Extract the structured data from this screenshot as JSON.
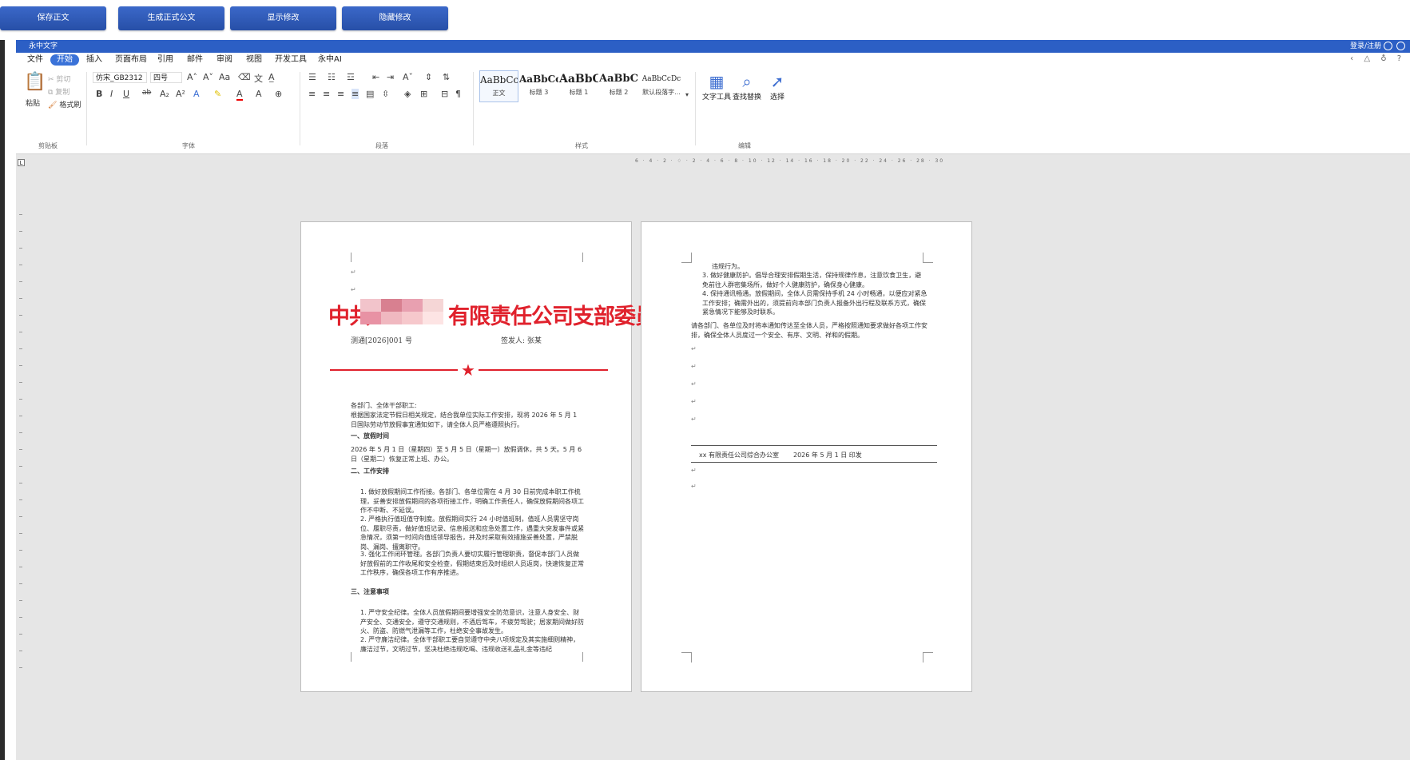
{
  "top_buttons": [
    "保存正文",
    "生成正式公文",
    "显示修改",
    "隐藏修改"
  ],
  "titlebar": {
    "app_name": "永中文字",
    "login": "登录/注册"
  },
  "menu": [
    "文件",
    "开始",
    "插入",
    "页面布局",
    "引用",
    "邮件",
    "审阅",
    "视图",
    "开发工具",
    "永中AI"
  ],
  "menu_active": "开始",
  "ribbon": {
    "clipboard": {
      "paste": "粘贴",
      "cut": "剪切",
      "copy": "复制",
      "format_painter": "格式刷",
      "group": "剪贴板"
    },
    "font": {
      "family": "仿宋_GB2312",
      "size": "四号",
      "group": "字体"
    },
    "paragraph": {
      "group": "段落"
    },
    "styles": {
      "group": "样式",
      "items": [
        {
          "sample": "AaBbCcI",
          "name": "正文"
        },
        {
          "sample": "AaBbCcI",
          "name": "标题 3"
        },
        {
          "sample": "AaBbCc",
          "name": "标题 1"
        },
        {
          "sample": "AaBbC",
          "name": "标题 2"
        },
        {
          "sample": "AaBbCcDc",
          "name": "默认段落字..."
        }
      ]
    },
    "editing": {
      "group": "编辑",
      "text_tools": "文字工具",
      "find_replace": "查找替换",
      "select": "选择"
    }
  },
  "ruler_numbers": "6 · 4 · 2 · ♢ · 2 · 4 · 6 · 8 · 10 · 12 · 14 · 16 · 18 · 20 · 22 · 24 · 26 · 28 · 30",
  "page1": {
    "header_left": "中共",
    "header_right": "有限责任公司支部委员会文件",
    "doc_no": "测通[2026]001 号",
    "signer": "签发人: 张某",
    "salutation": "各部门、全体干部职工:",
    "intro": "根据国家法定节假日相关规定，结合我单位实际工作安排，现将 2026 年 5 月 1 日国际劳动节放假事宜通知如下，请全体人员严格遵照执行。",
    "sec1": "一、放假时间",
    "sec1_text": "2026 年 5 月 1 日（星期四）至 5 月 5 日（星期一）放假调休，共 5 天。5 月 6 日（星期二）恢复正常上班、办公。",
    "sec2": "二、工作安排",
    "sec2_items": [
      "1. 做好放假期间工作衔接。各部门、各单位需在 4 月 30 日前完成本职工作梳理，妥善安排放假期间的各项衔接工作，明确工作责任人，确保放假期间各项工作不中断、不延误。",
      "2. 严格执行值班值守制度。放假期间实行 24 小时值班制，值班人员需坚守岗位、履职尽责，做好值班记录、信息报送和应急处置工作，遇重大突发事件或紧急情况，须第一时间向值班领导报告，并及时采取有效措施妥善处置，严禁脱岗、漏岗、擅离职守。",
      "3. 强化工作闭环管理。各部门负责人要切实履行管理职责，督促本部门人员做好放假前的工作收尾和安全检查，假期结束后及时组织人员返岗，快速恢复正常工作秩序，确保各项工作有序推进。"
    ],
    "sec3": "三、注意事项",
    "sec3_items": [
      "1. 严守安全纪律。全体人员放假期间要增强安全防范意识，注意人身安全、财产安全、交通安全，遵守交通规则，不酒后驾车，不疲劳驾驶；居家期间做好防火、防盗、防燃气泄漏等工作，杜绝安全事故发生。",
      "2. 严守廉洁纪律。全体干部职工要自觉遵守中央八项规定及其实施细则精神，廉洁过节，文明过节，坚决杜绝违规吃喝、违规收送礼品礼金等违纪"
    ]
  },
  "page2": {
    "cont": "违规行为。",
    "items": [
      "3. 做好健康防护。倡导合理安排假期生活，保持规律作息，注意饮食卫生，避免前往人群密集场所，做好个人健康防护，确保身心健康。",
      "4. 保持通讯畅通。放假期间，全体人员需保持手机 24 小时畅通，以便应对紧急工作安排；确需外出的，须提前向本部门负责人报备外出行程及联系方式，确保紧急情况下能够及时联系。"
    ],
    "closing": "请各部门、各单位及时将本通知传达至全体人员，严格按照通知要求做好各项工作安排，确保全体人员度过一个安全、有序、文明、祥和的假期。",
    "footer_org": "xx 有限责任公司综合办公室",
    "footer_date": "2026 年 5 月 1 日  印发"
  },
  "colors": {
    "brand_blue": "#2c5fc5",
    "red_header": "#e0212c"
  }
}
